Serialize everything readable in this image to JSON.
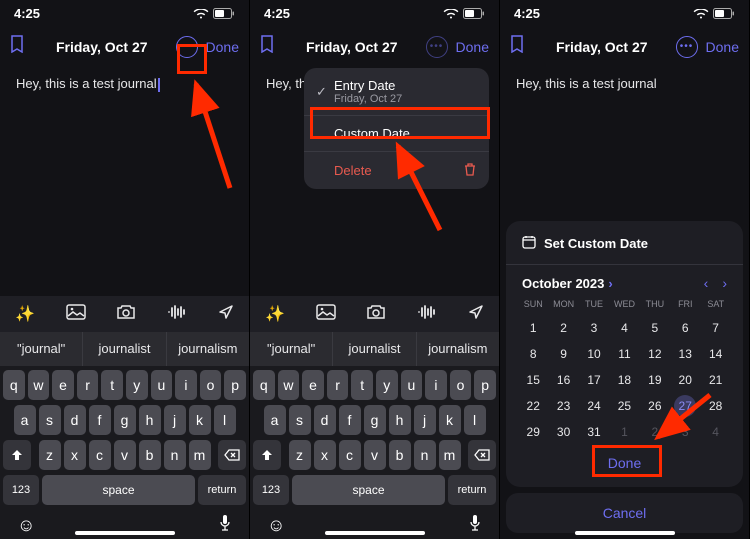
{
  "status": {
    "time": "4:25"
  },
  "common": {
    "date_title": "Friday, Oct 27",
    "done": "Done",
    "entry_text": "Hey, this is a test journal"
  },
  "predictions": [
    "\"journal\"",
    "journalist",
    "journalism"
  ],
  "keyboard": {
    "row1": [
      "q",
      "w",
      "e",
      "r",
      "t",
      "y",
      "u",
      "i",
      "o",
      "p"
    ],
    "row2": [
      "a",
      "s",
      "d",
      "f",
      "g",
      "h",
      "j",
      "k",
      "l"
    ],
    "row3": [
      "z",
      "x",
      "c",
      "v",
      "b",
      "n",
      "m"
    ],
    "num": "123",
    "space": "space",
    "return": "return"
  },
  "popup": {
    "entry_date_label": "Entry Date",
    "entry_date_sub": "Friday, Oct 27",
    "custom_date": "Custom Date",
    "delete": "Delete"
  },
  "calendar": {
    "sheet_title": "Set Custom Date",
    "month": "October 2023",
    "dow": [
      "SUN",
      "MON",
      "TUE",
      "WED",
      "THU",
      "FRI",
      "SAT"
    ],
    "rows": [
      [
        {
          "d": "1"
        },
        {
          "d": "2"
        },
        {
          "d": "3"
        },
        {
          "d": "4"
        },
        {
          "d": "5"
        },
        {
          "d": "6"
        },
        {
          "d": "7"
        }
      ],
      [
        {
          "d": "8"
        },
        {
          "d": "9"
        },
        {
          "d": "10"
        },
        {
          "d": "11"
        },
        {
          "d": "12"
        },
        {
          "d": "13"
        },
        {
          "d": "14"
        }
      ],
      [
        {
          "d": "15"
        },
        {
          "d": "16"
        },
        {
          "d": "17"
        },
        {
          "d": "18"
        },
        {
          "d": "19"
        },
        {
          "d": "20"
        },
        {
          "d": "21"
        }
      ],
      [
        {
          "d": "22"
        },
        {
          "d": "23"
        },
        {
          "d": "24"
        },
        {
          "d": "25"
        },
        {
          "d": "26"
        },
        {
          "d": "27",
          "sel": true
        },
        {
          "d": "28"
        }
      ],
      [
        {
          "d": "29"
        },
        {
          "d": "30"
        },
        {
          "d": "31"
        },
        {
          "d": "1",
          "o": true
        },
        {
          "d": "2",
          "o": true
        },
        {
          "d": "3",
          "o": true
        },
        {
          "d": "4",
          "o": true
        }
      ]
    ],
    "done": "Done",
    "cancel": "Cancel"
  }
}
